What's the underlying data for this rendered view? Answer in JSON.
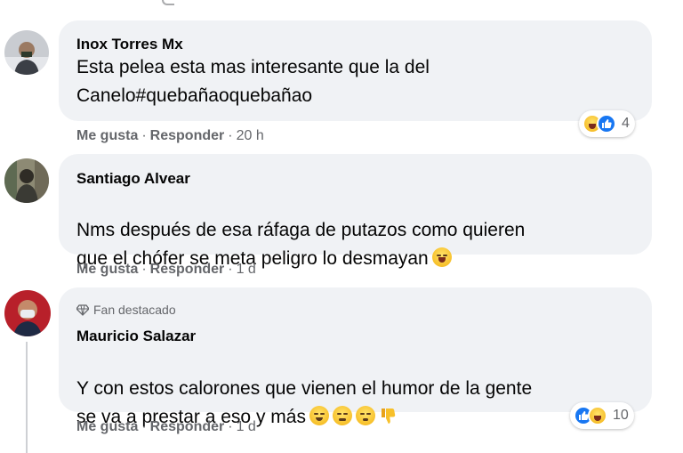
{
  "comments": [
    {
      "author": "Inox Torres Mx",
      "text": "Esta pelea esta mas interesante que la del\nCanelo#quebañaoquebañao",
      "actions": {
        "like": "Me gusta",
        "reply": "Responder",
        "time": "20 h"
      },
      "reactions": {
        "icons": [
          "haha-icon",
          "like-icon"
        ],
        "count": "4"
      },
      "avatar": "avatar-profile-photo"
    },
    {
      "author": "Santiago Alvear",
      "text": "Nms después de esa ráfaga de putazos como quieren\nque el chófer se meta peligro lo desmayan",
      "trailing_emoji": [
        "grinning-squinting-face-icon"
      ],
      "actions": {
        "like": "Me gusta",
        "reply": "Responder",
        "time": "1 d"
      },
      "avatar": "avatar-profile-photo"
    },
    {
      "badge": "Fan destacado",
      "author": "Mauricio Salazar",
      "text": "Y con estos calorones que vienen el humor de la gente\nse va a prestar a eso y más",
      "trailing_emoji": [
        "relieved-face-icon",
        "expressionless-face-icon",
        "pensive-face-icon",
        "thumbs-down-icon"
      ],
      "actions": {
        "like": "Me gusta",
        "reply": "Responder",
        "time": "1 d"
      },
      "reactions": {
        "icons": [
          "like-icon",
          "haha-icon"
        ],
        "count": "10"
      },
      "avatar": "avatar-profile-photo"
    }
  ],
  "separator": "·",
  "colors": {
    "bubble": "#f0f2f5",
    "secondary_text": "#65676b",
    "like_blue": "#1877f2",
    "emoji_yellow": "#f7c02a"
  }
}
